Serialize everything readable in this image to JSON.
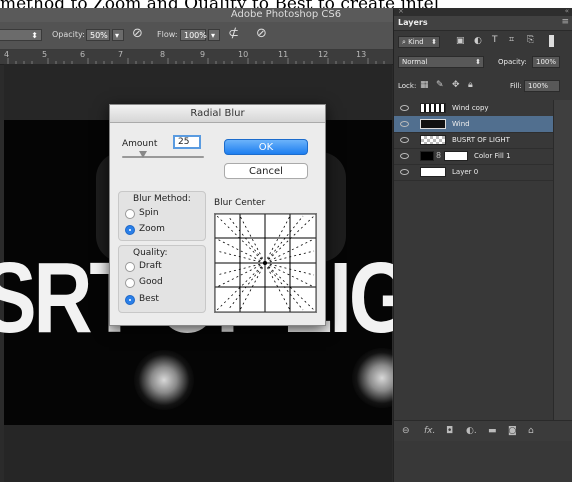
{
  "page_top_text": "method to Zoom and Quality to Best to create intel",
  "app": {
    "title": "Adobe Photoshop CS6"
  },
  "options_bar": {
    "opacity_label": "Opacity:",
    "opacity_value": "50%",
    "flow_label": "Flow:",
    "flow_value": "100%"
  },
  "ruler": {
    "ticks": [
      "4",
      "5",
      "6",
      "7",
      "8",
      "9",
      "10",
      "11",
      "12",
      "13"
    ]
  },
  "canvas": {
    "text": "SRT OF LIG"
  },
  "radial_blur": {
    "title": "Radial Blur",
    "amount_label": "Amount",
    "amount_value": "25",
    "ok_label": "OK",
    "cancel_label": "Cancel",
    "blur_method_label": "Blur Method:",
    "blur_methods": [
      {
        "label": "Spin",
        "selected": false
      },
      {
        "label": "Zoom",
        "selected": true
      }
    ],
    "quality_label": "Quality:",
    "qualities": [
      {
        "label": "Draft",
        "selected": false
      },
      {
        "label": "Good",
        "selected": false
      },
      {
        "label": "Best",
        "selected": true
      }
    ],
    "blur_center_label": "Blur Center"
  },
  "layers_panel": {
    "tab_label": "Layers",
    "filter_label": "Kind",
    "blend_mode": "Normal",
    "opacity_label": "Opacity:",
    "opacity_value": "100%",
    "lock_label": "Lock:",
    "fill_label": "Fill:",
    "fill_value": "100%",
    "layers": [
      {
        "name": "Wind copy",
        "selected": false
      },
      {
        "name": "Wind",
        "selected": true
      },
      {
        "name": "BUSRT OF LIGHT",
        "selected": false
      },
      {
        "name": "Color Fill 1",
        "selected": false
      },
      {
        "name": "Layer 0",
        "selected": false
      }
    ],
    "footer_icons": [
      "link-icon",
      "fx-icon",
      "mask-icon",
      "adjustment-icon",
      "folder-icon",
      "new-layer-icon",
      "trash-icon"
    ]
  }
}
